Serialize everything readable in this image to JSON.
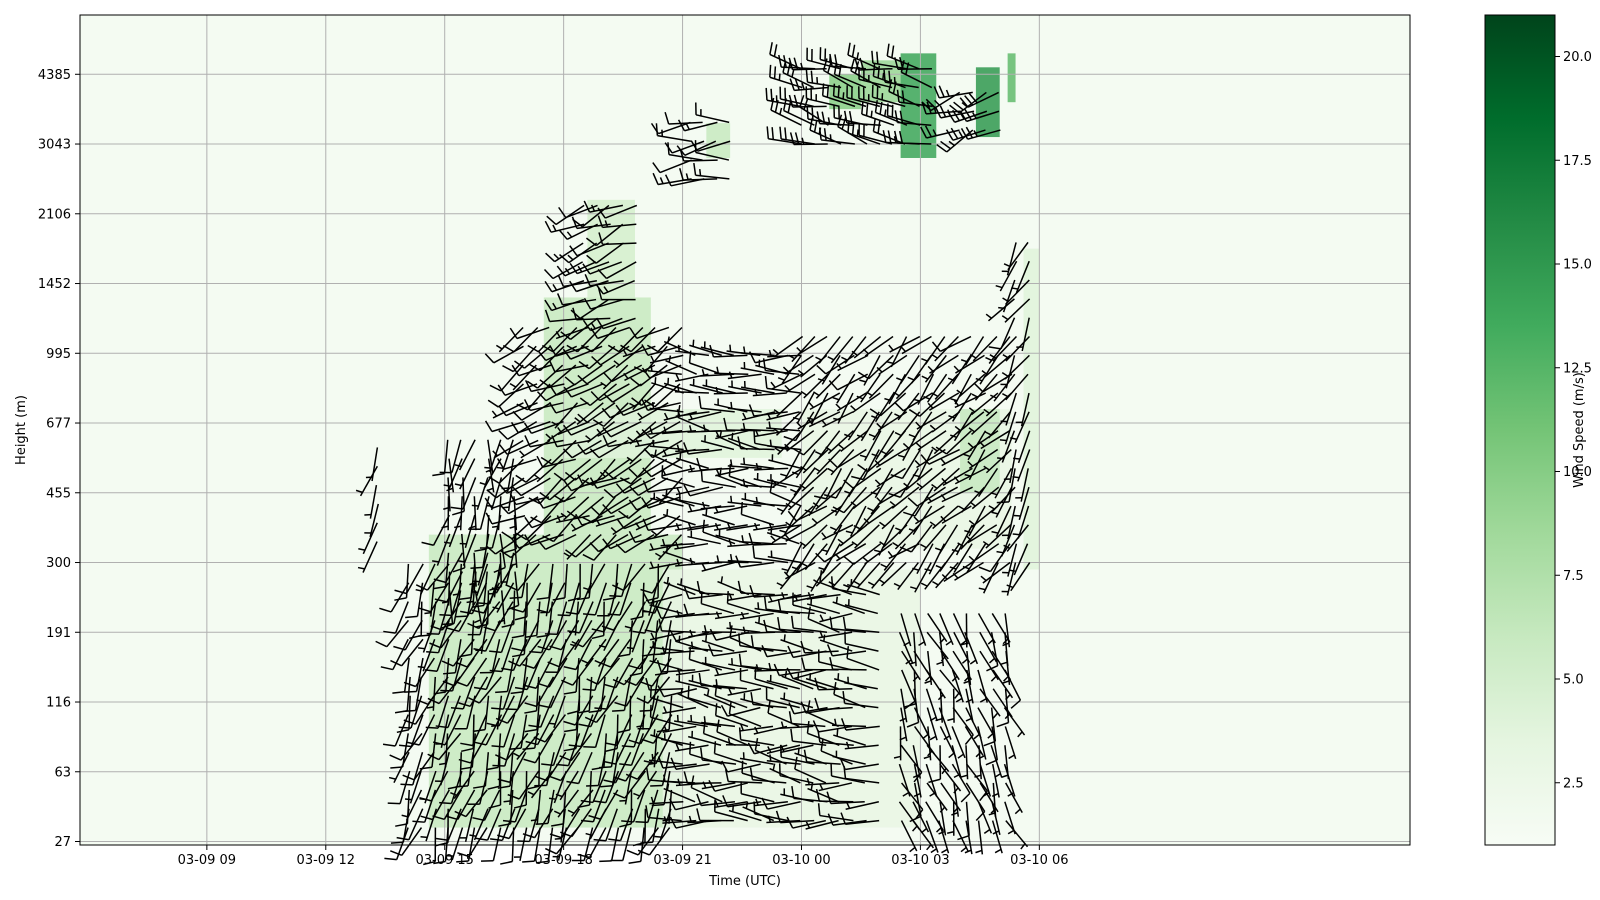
{
  "chart_data": {
    "type": "heatmap",
    "title": "",
    "xlabel": "Time (UTC)",
    "ylabel": "Height (m)",
    "x_range_hours": [
      -3.2,
      30.35
    ],
    "x_ticks": [
      {
        "hours": 0,
        "label": "03-09 09"
      },
      {
        "hours": 3,
        "label": "03-09 12"
      },
      {
        "hours": 6,
        "label": "03-09 15"
      },
      {
        "hours": 9,
        "label": "03-09 18"
      },
      {
        "hours": 12,
        "label": "03-09 21"
      },
      {
        "hours": 15,
        "label": "03-10 00"
      },
      {
        "hours": 18,
        "label": "03-10 03"
      },
      {
        "hours": 21,
        "label": "03-10 06"
      }
    ],
    "y_ticks": [
      "27",
      "63",
      "116",
      "191",
      "300",
      "455",
      "677",
      "995",
      "1452",
      "2106",
      "3043",
      "4385"
    ],
    "grid": true,
    "colorbar": {
      "label": "Wind Speed (m/s)",
      "range": [
        1,
        21
      ],
      "ticks": [
        "2.5",
        "5.0",
        "7.5",
        "10.0",
        "12.5",
        "15.0",
        "17.5",
        "20.0"
      ],
      "colormap": "Greens"
    },
    "speed_regions": [
      {
        "t0": 5.6,
        "t1": 12.0,
        "h0": 0.2,
        "h1": 4.4,
        "speed": 6
      },
      {
        "t0": 8.5,
        "t1": 11.2,
        "h0": 4.4,
        "h1": 7.8,
        "speed": 6
      },
      {
        "t0": 9.6,
        "t1": 10.8,
        "h0": 7.8,
        "h1": 9.2,
        "speed": 5
      },
      {
        "t0": 9.0,
        "t1": 14.5,
        "h0": 5.5,
        "h1": 6.2,
        "speed": 4
      },
      {
        "t0": 6.4,
        "t1": 7.0,
        "h0": 3.6,
        "h1": 4.4,
        "speed": 5
      },
      {
        "t0": 11.5,
        "t1": 18.0,
        "h0": 0.2,
        "h1": 3.9,
        "speed": 3
      },
      {
        "t0": 15.0,
        "t1": 20.3,
        "h0": 4.2,
        "h1": 6.2,
        "speed": 3
      },
      {
        "t0": 19.0,
        "t1": 20.0,
        "h0": 5.0,
        "h1": 6.2,
        "speed": 6
      },
      {
        "t0": 20.6,
        "t1": 21.0,
        "h0": 3.9,
        "h1": 8.5,
        "speed": 4
      },
      {
        "t0": 15.7,
        "t1": 16.5,
        "h0": 10.5,
        "h1": 11.0,
        "speed": 10
      },
      {
        "t0": 16.5,
        "t1": 17.5,
        "h0": 10.6,
        "h1": 11.2,
        "speed": 9
      },
      {
        "t0": 17.5,
        "t1": 18.4,
        "h0": 9.8,
        "h1": 11.3,
        "speed": 14
      },
      {
        "t0": 19.4,
        "t1": 20.0,
        "h0": 10.1,
        "h1": 11.1,
        "speed": 15
      },
      {
        "t0": 20.2,
        "t1": 20.4,
        "h0": 10.6,
        "h1": 11.3,
        "speed": 12
      },
      {
        "t0": 12.6,
        "t1": 13.2,
        "h0": 9.8,
        "h1": 10.3,
        "speed": 6
      }
    ],
    "barb_clusters": [
      {
        "t0": 5.1,
        "t1": 12.0,
        "h0": 0.2,
        "h1": 4.2,
        "dir": 200,
        "speed": 6
      },
      {
        "t0": 8.0,
        "t1": 12.0,
        "h0": 4.4,
        "h1": 7.4,
        "dir": 240,
        "speed": 6
      },
      {
        "t0": 9.5,
        "t1": 11.0,
        "h0": 7.5,
        "h1": 9.2,
        "dir": 250,
        "speed": 7
      },
      {
        "t0": 6.1,
        "t1": 8.0,
        "h0": 3.6,
        "h1": 5.8,
        "dir": 190,
        "speed": 5
      },
      {
        "t0": 12.0,
        "t1": 17.0,
        "h0": 0.3,
        "h1": 3.8,
        "dir": 275,
        "speed": 5
      },
      {
        "t0": 12.0,
        "t1": 15.0,
        "h0": 4.0,
        "h1": 7.0,
        "dir": 275,
        "speed": 4
      },
      {
        "t0": 15.0,
        "t1": 20.5,
        "h0": 4.0,
        "h1": 7.5,
        "dir": 225,
        "speed": 4
      },
      {
        "t0": 17.5,
        "t1": 20.2,
        "h0": 0.3,
        "h1": 3.5,
        "dir": 160,
        "speed": 4
      },
      {
        "t0": 20.4,
        "t1": 21.0,
        "h0": 4.0,
        "h1": 8.8,
        "dir": 210,
        "speed": 4
      },
      {
        "t0": 15.0,
        "t1": 18.5,
        "h0": 10.0,
        "h1": 11.3,
        "dir": 285,
        "speed": 12
      },
      {
        "t0": 19.0,
        "t1": 20.0,
        "h0": 10.2,
        "h1": 11.0,
        "dir": 250,
        "speed": 14
      },
      {
        "t0": 12.2,
        "t1": 13.2,
        "h0": 9.5,
        "h1": 10.4,
        "dir": 265,
        "speed": 7
      },
      {
        "t0": 4.3,
        "t1": 4.4,
        "h0": 4.3,
        "h1": 5.8,
        "dir": 200,
        "speed": 4
      }
    ]
  }
}
